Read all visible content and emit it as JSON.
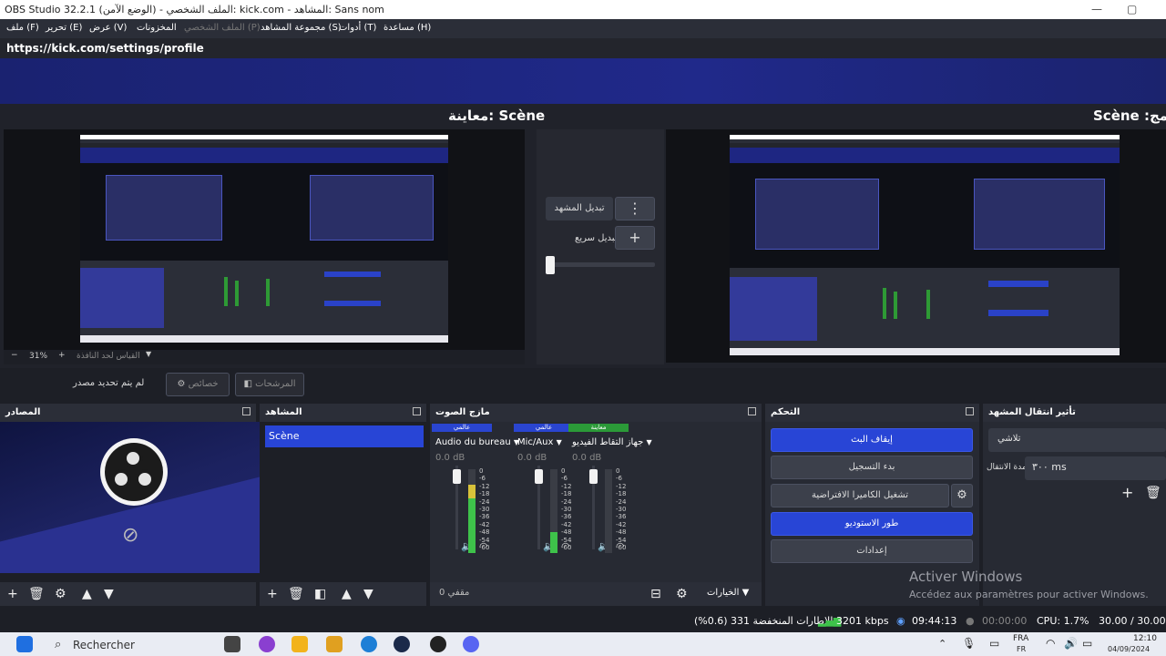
{
  "window": {
    "title": "OBS Studio 32.2.1 (الوضع الآمن) - الملف الشخصي: kick.com - المشاهد: Sans nom",
    "controls": {
      "minimize": "—",
      "maximize": "▢"
    }
  },
  "menu": {
    "items": [
      {
        "label": "ملف (F)"
      },
      {
        "label": "تحرير (E)"
      },
      {
        "label": "عرض (V)"
      },
      {
        "label": "المخزونات"
      },
      {
        "label": "الملف الشخصي (P)"
      },
      {
        "label": "مجموعة المشاهد (S)"
      },
      {
        "label": "أدوات (T)"
      },
      {
        "label": "مساعدة (H)"
      }
    ]
  },
  "browser": {
    "url": "https://kick.com/settings/profile"
  },
  "preview": {
    "left_title": "معاينة: Scène",
    "right_title": "Scène :برنامج",
    "zoom": "31%",
    "zoom_minus": "−",
    "zoom_plus": "+",
    "scale_hint": "القياس لحد النافذة"
  },
  "transition_panel": {
    "change_scene": "تبديل المشهد",
    "quick_switch": "تبديل سريع",
    "menu_icon": "⋮",
    "plus_icon": "+"
  },
  "filters_bar": {
    "no_source": "لم يتم تحديد مصدر",
    "properties": "خصائص",
    "filters": "المرشحات"
  },
  "docks": {
    "sources": {
      "title": "المصادر"
    },
    "scenes": {
      "title": "المشاهد",
      "items": [
        "Scène"
      ]
    },
    "mixer": {
      "title": "مازج الصوت",
      "channels": [
        {
          "tag": "عالمي",
          "name": "Audio du bureau",
          "db": "0.0 dB",
          "color": "#2a45d0",
          "level": 0.82
        },
        {
          "tag": "عالمي",
          "name": "Mic/Aux",
          "db": "0.0 dB",
          "color": "#2a45d0",
          "level": 0.25
        },
        {
          "tag": "معاينة",
          "name": "جهاز التقاط الفيديو",
          "db": "0.0 dB",
          "color": "#2b9a38",
          "level": 0.0
        }
      ],
      "ticks": [
        "0",
        "-6",
        "-12",
        "-18",
        "-24",
        "-30",
        "-36",
        "-42",
        "-48",
        "-54",
        "-60"
      ],
      "footer_muted": "مقفي 0",
      "footer_options": "الخيارات"
    },
    "controls": {
      "title": "التحكم",
      "stop_stream": "إيقاف البث",
      "start_record": "بدء التسجيل",
      "virtual_cam": "تشغيل الكاميرا الافتراضية",
      "studio_mode": "طور الاستوديو",
      "settings": "إعدادات"
    },
    "transitions": {
      "title": "تأثير انتقال المشهد",
      "type": "تلاشي",
      "duration_label": "مدة الانتقال",
      "duration_value": "٣٠٠ ms"
    }
  },
  "status": {
    "dropped": "الإطارات المنخفضة 331 (0.6%)",
    "bitrate": "3201 kbps",
    "stream_time": "09:44:13",
    "rec_time": "00:00:00",
    "cpu": "CPU: 1.7%",
    "fps": "30.00 / 30.00 FPS"
  },
  "watermark": {
    "title": "Activer Windows",
    "subtitle": "Accédez aux paramètres pour activer Windows."
  },
  "taskbar": {
    "search": "Rechercher",
    "lang": "FRA",
    "region": "FR",
    "time": "12:10",
    "date": "04/09/2024"
  }
}
